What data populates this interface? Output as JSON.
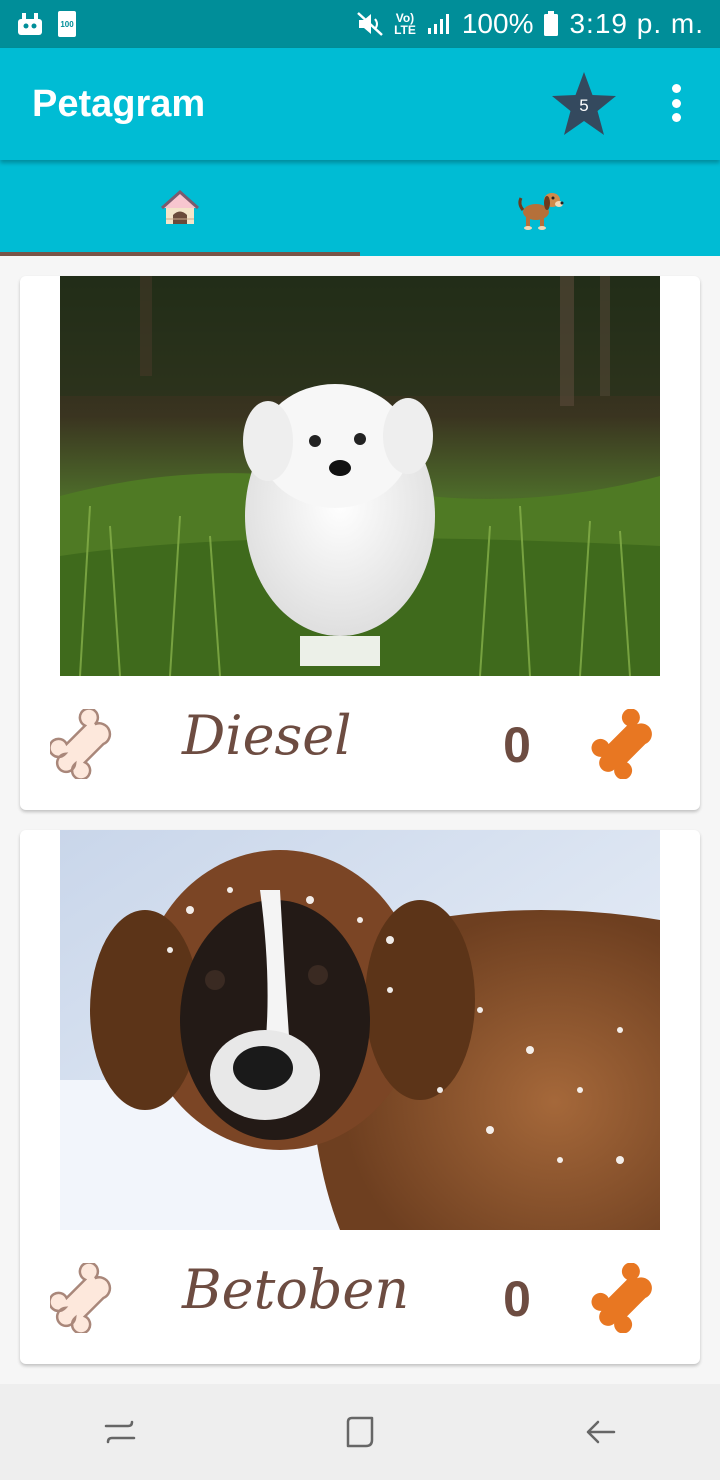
{
  "status_bar": {
    "lte_top": "Vo)",
    "lte_bottom": "LTE",
    "battery": "100%",
    "time": "3:19 p. m.",
    "battery_icon_text": "100"
  },
  "app_bar": {
    "title": "Petagram",
    "favorites_count": "5"
  },
  "tabs": [
    {
      "icon": "dog-house-icon",
      "selected": true
    },
    {
      "icon": "dog-icon",
      "selected": false
    }
  ],
  "pets": [
    {
      "name": "Diesel",
      "likes": "0",
      "photo": "white-maltese-puppy-in-grass"
    },
    {
      "name": "Betoben",
      "likes": "0",
      "photo": "saint-bernard-in-snow"
    }
  ],
  "colors": {
    "status_bar": "#008e99",
    "primary": "#00bcd4",
    "accent_bone": "#e87722",
    "text_brown": "#6d4c41",
    "indicator": "#795548"
  }
}
